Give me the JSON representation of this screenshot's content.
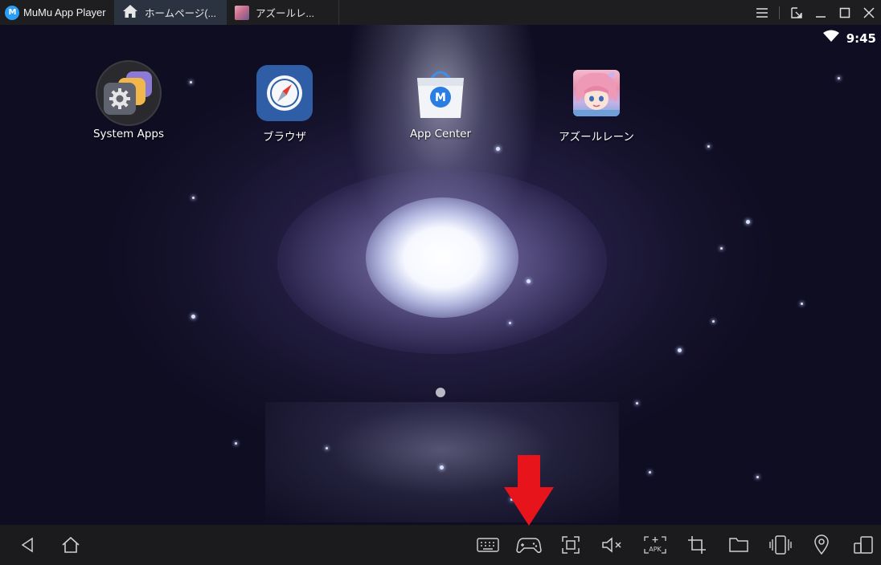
{
  "titlebar": {
    "app_name": "MuMu App Player",
    "logo_letter": "M",
    "tabs": [
      {
        "label": "ホームページ(...",
        "icon": "home-icon",
        "active": true
      },
      {
        "label": "アズールレ...",
        "icon": "game-thumbnail-icon",
        "active": false
      }
    ],
    "controls": [
      "menu-icon",
      "restore-window-icon",
      "minimize-icon",
      "maximize-icon",
      "close-icon"
    ]
  },
  "status_bar": {
    "time": "9:45",
    "wifi_icon": "wifi-icon"
  },
  "home_screen": {
    "apps": [
      {
        "label": "System Apps",
        "icon": "system-apps-folder-icon"
      },
      {
        "label": "ブラウザ",
        "icon": "browser-compass-icon"
      },
      {
        "label": "App Center",
        "icon": "app-center-bag-icon"
      },
      {
        "label": "アズールレーン",
        "icon": "azur-lane-icon"
      }
    ],
    "page_indicator_count": 1
  },
  "bottom_toolbar": {
    "left": [
      "back-icon",
      "home-icon"
    ],
    "right": [
      "keyboard-icon",
      "gamepad-icon",
      "screenshot-icon",
      "volume-mute-icon",
      "apk-install-icon",
      "crop-icon",
      "folder-icon",
      "shake-icon",
      "location-icon",
      "multi-window-icon"
    ],
    "apk_text": "APK"
  },
  "annotation": {
    "arrow_color": "#e8141c",
    "points_to": "gamepad-icon"
  },
  "colors": {
    "titlebar_bg": "#1e1e20",
    "active_tab_bg": "#2c3340",
    "brand_blue": "#2a9df4",
    "bottombar_bg": "#1b1b1d"
  }
}
